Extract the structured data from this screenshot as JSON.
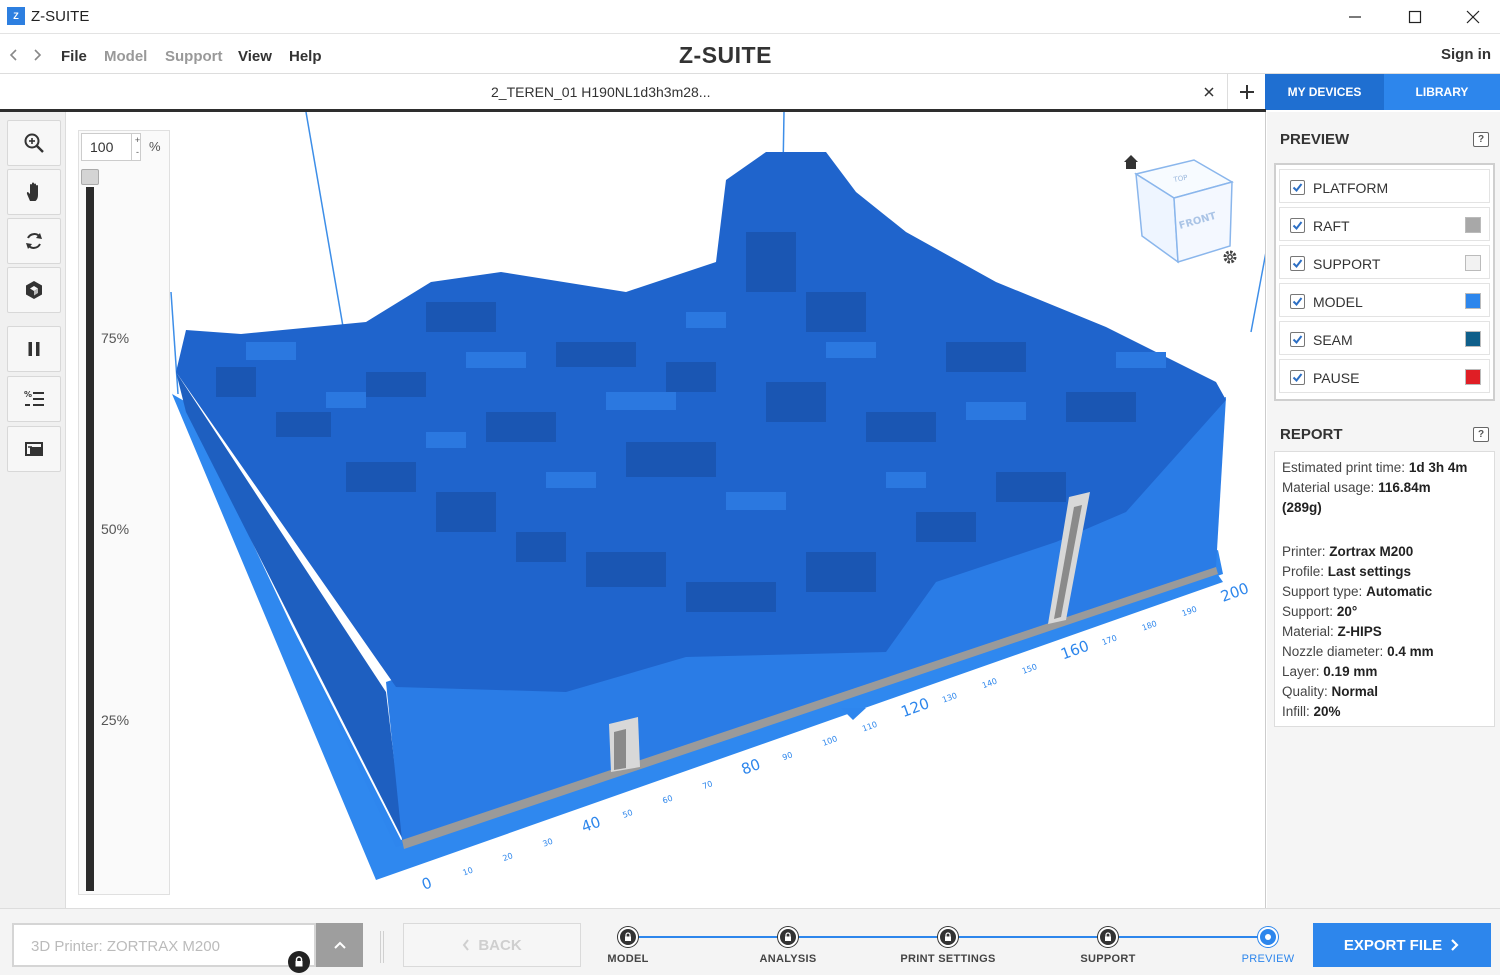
{
  "window": {
    "app_logo": "Z",
    "app_title": "Z-SUITE"
  },
  "menu": {
    "items": [
      {
        "label": "File",
        "enabled": true
      },
      {
        "label": "Model",
        "enabled": false
      },
      {
        "label": "Support",
        "enabled": false
      },
      {
        "label": "View",
        "enabled": true
      },
      {
        "label": "Help",
        "enabled": true
      }
    ],
    "brand": "Z-SUITE",
    "sign_in": "Sign in"
  },
  "tabs": {
    "file_tab": "2_TEREN_01 H190NL1d3h3m28...",
    "my_devices": "MY DEVICES",
    "library": "LIBRARY"
  },
  "toolbar": {
    "tools": [
      "zoom-tool",
      "pan-tool",
      "rotate-tool",
      "view-cube-tool",
      "pause-tool",
      "layer-settings-tool",
      "layer-preview-tool"
    ]
  },
  "layer_slider": {
    "zoom_value": "100",
    "zoom_unit": "%",
    "spin_up": "+",
    "spin_down": "-",
    "marks": [
      "75%",
      "50%",
      "25%"
    ],
    "level": 1.0
  },
  "viewport": {
    "axis_major_labels": [
      "0",
      "40",
      "80",
      "120",
      "160",
      "200"
    ],
    "axis_minor_labels": [
      "10",
      "20",
      "30",
      "50",
      "60",
      "70",
      "90",
      "100",
      "110",
      "130",
      "140",
      "150",
      "170",
      "180",
      "190"
    ],
    "view_cube": {
      "top": "TOP",
      "front": "FRONT"
    },
    "colors": {
      "model": "#2a74dc",
      "platform": "#2d86ec"
    }
  },
  "preview": {
    "title": "PREVIEW",
    "help": "?",
    "layers": [
      {
        "label": "PLATFORM",
        "checked": true,
        "color": null
      },
      {
        "label": "RAFT",
        "checked": true,
        "color": "#a8a8a8"
      },
      {
        "label": "SUPPORT",
        "checked": true,
        "color": "#f2f2f2"
      },
      {
        "label": "MODEL",
        "checked": true,
        "color": "#2d86ec"
      },
      {
        "label": "SEAM",
        "checked": true,
        "color": "#0f5f8a"
      },
      {
        "label": "PAUSE",
        "checked": true,
        "color": "#e01e25"
      }
    ]
  },
  "report": {
    "title": "REPORT",
    "help": "?",
    "estimated_print_time": {
      "label": "Estimated print time:",
      "value": "1d 3h 4m"
    },
    "material_usage": {
      "label": "Material usage:",
      "value": "116.84m",
      "weight": "(289g)"
    },
    "details": [
      {
        "label": "Printer:",
        "value": "Zortrax M200"
      },
      {
        "label": "Profile:",
        "value": "Last settings"
      },
      {
        "label": "Support type:",
        "value": "Automatic"
      },
      {
        "label": "Support:",
        "value": "20°"
      },
      {
        "label": "Material:",
        "value": "Z-HIPS"
      },
      {
        "label": "Nozzle diameter:",
        "value": "0.4 mm"
      },
      {
        "label": "Layer:",
        "value": "0.19 mm"
      },
      {
        "label": "Quality:",
        "value": "Normal"
      },
      {
        "label": "Infill:",
        "value": "20%"
      }
    ]
  },
  "bottom": {
    "printer_select": "3D Printer: ZORTRAX M200",
    "back": "BACK",
    "steps": [
      {
        "label": "MODEL",
        "active": false
      },
      {
        "label": "ANALYSIS",
        "active": false
      },
      {
        "label": "PRINT SETTINGS",
        "active": false
      },
      {
        "label": "SUPPORT",
        "active": false
      },
      {
        "label": "PREVIEW",
        "active": true
      }
    ],
    "export": "EXPORT FILE"
  }
}
